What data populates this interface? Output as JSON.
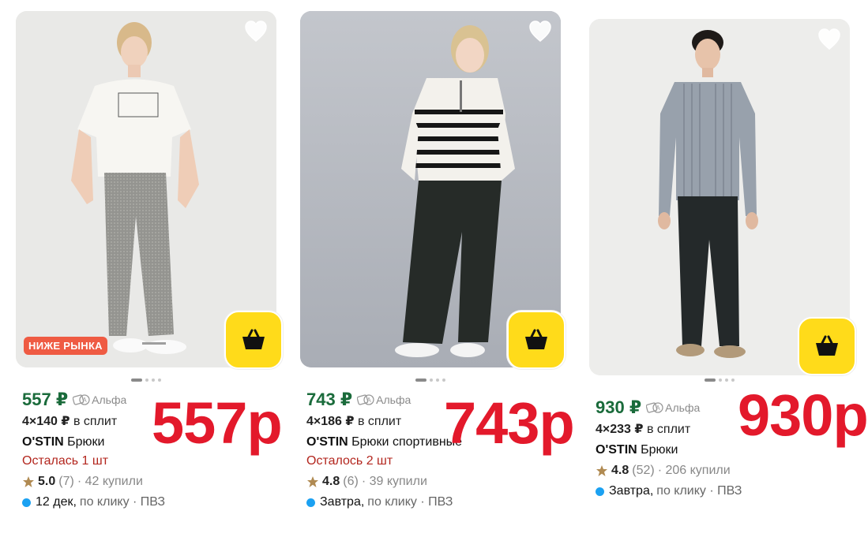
{
  "cards": [
    {
      "price": "557 ₽",
      "alfa": "Альфа",
      "split_amount": "4×140 ₽",
      "split_text": "в сплит",
      "brand": "O'STIN",
      "name": "Брюки",
      "stock": "Осталась 1 шт",
      "rating": "5.0",
      "reviews": "(7)",
      "bought": "· 42 купили",
      "delivery_when": "12 дек,",
      "delivery_rest": "по клику · ПВЗ",
      "badge": "НИЖЕ РЫНКА",
      "overlay_price": "557р"
    },
    {
      "price": "743 ₽",
      "alfa": "Альфа",
      "split_amount": "4×186 ₽",
      "split_text": "в сплит",
      "brand": "O'STIN",
      "name": "Брюки спортивные",
      "stock": "Осталось 2 шт",
      "rating": "4.8",
      "reviews": "(6)",
      "bought": "· 39 купили",
      "delivery_when": "Завтра,",
      "delivery_rest": "по клику · ПВЗ",
      "overlay_price": "743р"
    },
    {
      "price": "930 ₽",
      "alfa": "Альфа",
      "split_amount": "4×233 ₽",
      "split_text": "в сплит",
      "brand": "O'STIN",
      "name": "Брюки",
      "rating": "4.8",
      "reviews": "(52)",
      "bought": "· 206 купили",
      "delivery_when": "Завтра,",
      "delivery_rest": "по клику · ПВЗ",
      "overlay_price": "930р"
    }
  ],
  "colors": {
    "price_green": "#1a6b3b",
    "stock_red": "#b3261e",
    "overlay_red": "#e3192b",
    "cart_yellow": "#ffdb1a",
    "delivery_blue": "#1ba1f2",
    "star": "#b08a52",
    "badge_bg": "#ef5b43"
  }
}
